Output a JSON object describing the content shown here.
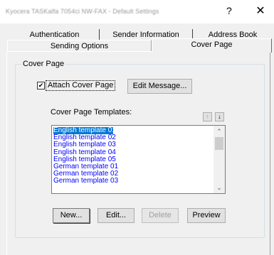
{
  "window": {
    "title": "Kyocera TASKalfa 7054ci NW-FAX - Default Settings",
    "help_label": "?",
    "close_label": "✕"
  },
  "tabs": {
    "row1": [
      "Authentication",
      "Sender Information",
      "Address Book"
    ],
    "row2": [
      "Sending Options",
      "Cover Page"
    ],
    "active": "Cover Page"
  },
  "cover_page": {
    "group_label": "Cover Page",
    "attach_label": "Attach Cover Page",
    "attach_checked": true,
    "check_mark": "✔",
    "edit_message_label": "Edit Message...",
    "templates_label": "Cover Page Templates:",
    "move_up_icon": "↑",
    "move_down_icon": "↓",
    "templates": [
      "English template 01",
      "English template 02",
      "English template 03",
      "English template 04",
      "English template 05",
      "German template 01",
      "German template 02",
      "German template 03"
    ],
    "selected_index": 0,
    "scroll_up_icon": "⌃",
    "scroll_down_icon": "⌄",
    "buttons": {
      "new": "New...",
      "edit": "Edit...",
      "delete": "Delete",
      "preview": "Preview"
    }
  }
}
